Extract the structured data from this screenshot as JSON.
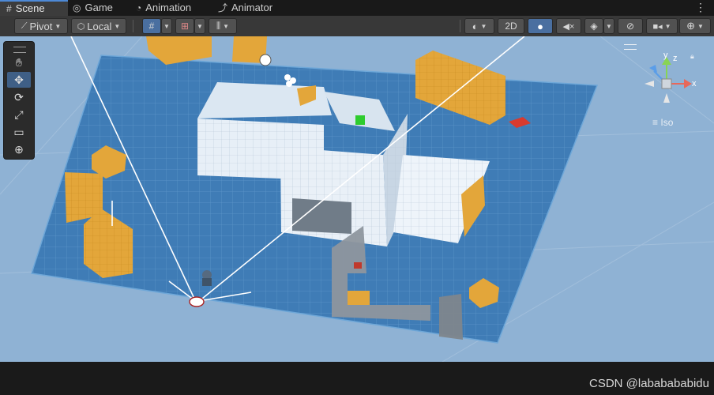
{
  "tabs": [
    {
      "label": "Scene",
      "icon": "grid-icon",
      "active": true
    },
    {
      "label": "Game",
      "icon": "gamepad-icon",
      "active": false
    },
    {
      "label": "Animation",
      "icon": "clock-icon",
      "active": false
    },
    {
      "label": "Animator",
      "icon": "animator-icon",
      "active": false
    }
  ],
  "toolbar": {
    "pivot_label": "Pivot",
    "local_label": "Local",
    "mode_2d_label": "2D"
  },
  "gizmo": {
    "projection_label": "Iso",
    "axis_x": "x",
    "axis_y": "y",
    "axis_z": "z"
  },
  "watermark": "CSDN @lababababidu",
  "colors": {
    "floor": "#3f7cb6",
    "background": "#8fb2d4",
    "prop_orange": "#e3a63a",
    "building_white": "#e6eef6"
  }
}
